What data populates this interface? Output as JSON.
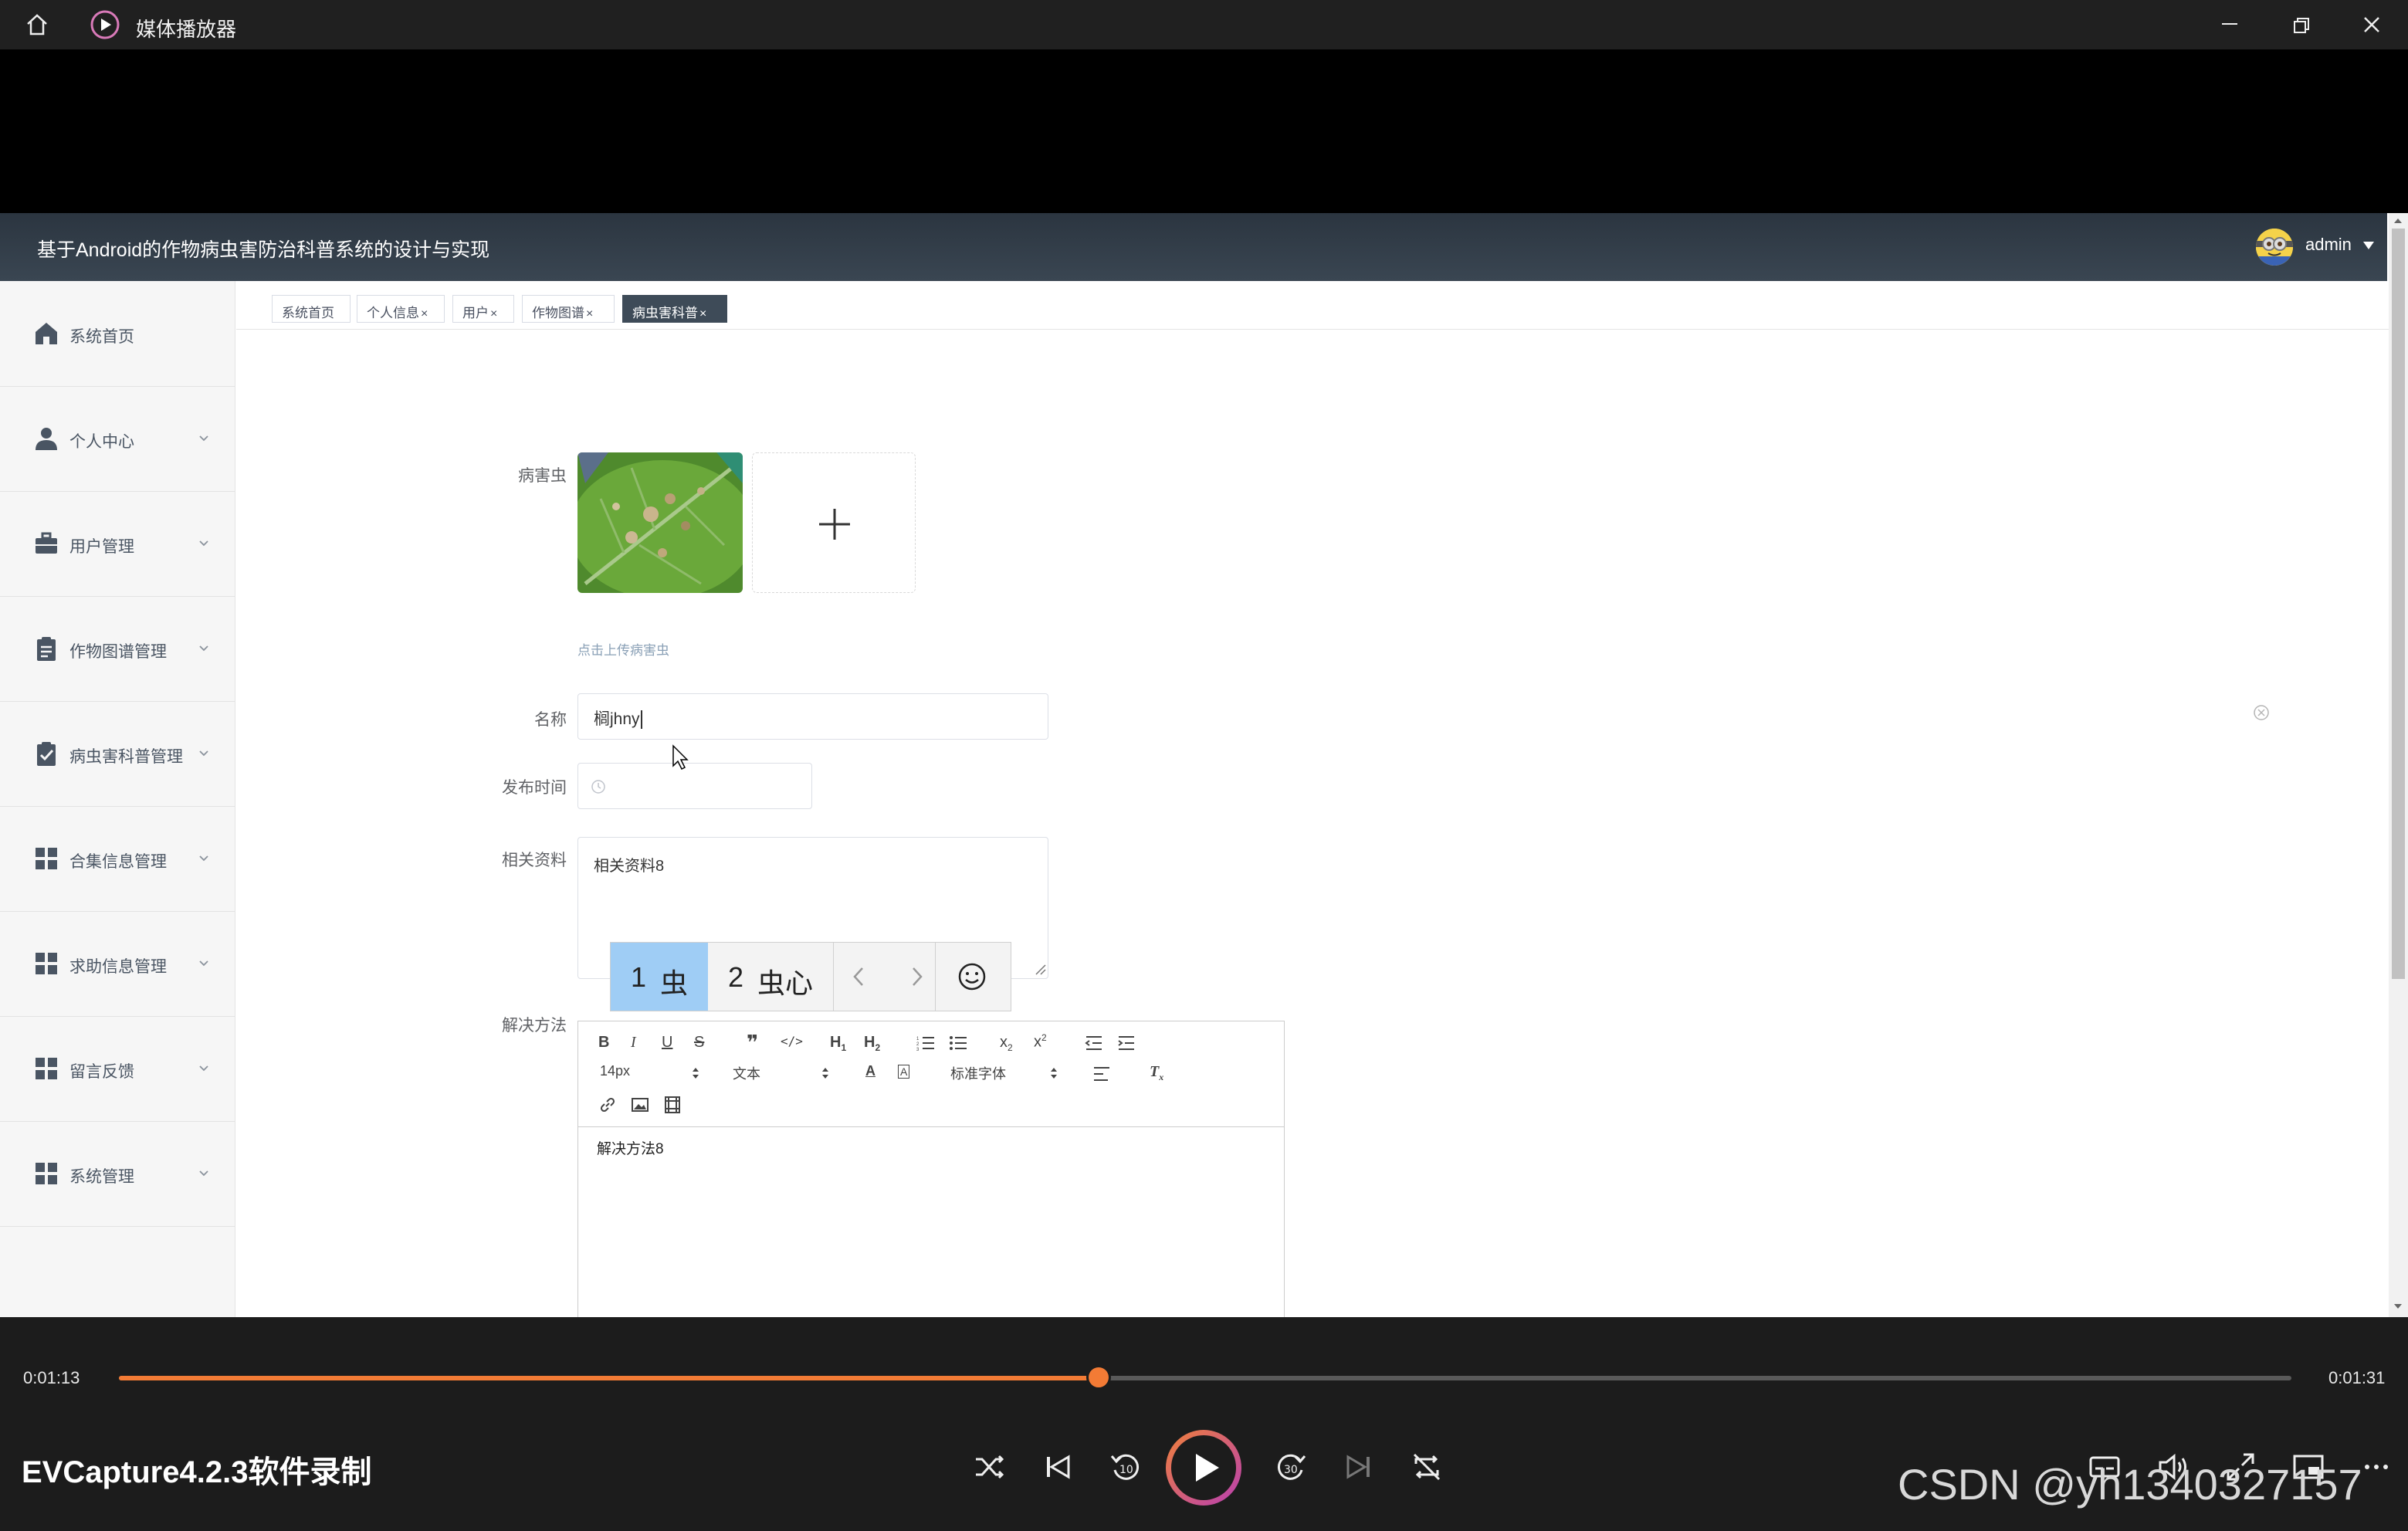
{
  "window": {
    "title": "媒体播放器"
  },
  "app": {
    "header_title": "基于Android的作物病虫害防治科普系统的设计与实现",
    "user": "admin",
    "sidebar": [
      {
        "label": "系统首页",
        "icon": "home-icon",
        "has_chevron": false
      },
      {
        "label": "个人中心",
        "icon": "user-icon",
        "has_chevron": true
      },
      {
        "label": "用户管理",
        "icon": "briefcase-icon",
        "has_chevron": true
      },
      {
        "label": "作物图谱管理",
        "icon": "clipboard-icon",
        "has_chevron": true
      },
      {
        "label": "病虫害科普管理",
        "icon": "checklist-icon",
        "has_chevron": true
      },
      {
        "label": "合集信息管理",
        "icon": "grid-icon",
        "has_chevron": true
      },
      {
        "label": "求助信息管理",
        "icon": "grid-icon",
        "has_chevron": true
      },
      {
        "label": "留言反馈",
        "icon": "grid-icon",
        "has_chevron": true
      },
      {
        "label": "系统管理",
        "icon": "grid-icon",
        "has_chevron": true
      }
    ],
    "tabs": [
      {
        "label": "系统首页",
        "closable": false,
        "active": false
      },
      {
        "label": "个人信息",
        "closable": true,
        "active": false
      },
      {
        "label": "用户",
        "closable": true,
        "active": false
      },
      {
        "label": "作物图谱",
        "closable": true,
        "active": false
      },
      {
        "label": "病虫害科普",
        "closable": true,
        "active": true
      }
    ],
    "form": {
      "pest_label": "病害虫",
      "upload_hint": "点击上传病害虫",
      "name_label": "名称",
      "name_value": "榈jhny",
      "publish_time_label": "发布时间",
      "related_label": "相关资料",
      "related_value": "相关资料8",
      "solution_label": "解决方法",
      "editor": {
        "font_size": "14px",
        "block_type": "文本",
        "font_family": "标准字体",
        "content": "解决方法8"
      }
    },
    "ime": {
      "candidates": [
        {
          "index": "1",
          "text": "虫"
        },
        {
          "index": "2",
          "text": "虫心"
        }
      ]
    }
  },
  "player": {
    "elapsed": "0:01:13",
    "duration": "0:01:31",
    "progress_fraction": 0.451,
    "recorder_label": "EVCapture4.2.3软件录制",
    "accent_color": "#f37b35"
  },
  "watermark": "CSDN @yh1340327157"
}
